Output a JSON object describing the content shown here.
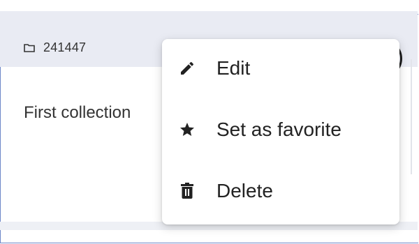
{
  "card": {
    "id": "241447",
    "name": "First collection"
  },
  "menu": {
    "items": [
      {
        "label": "Edit",
        "icon": "pencil-icon"
      },
      {
        "label": "Set as favorite",
        "icon": "star-icon"
      },
      {
        "label": "Delete",
        "icon": "trash-icon"
      }
    ]
  },
  "colors": {
    "frame_border": "#6d87c8",
    "header_bg": "#e9ebf3",
    "text": "#333333"
  }
}
